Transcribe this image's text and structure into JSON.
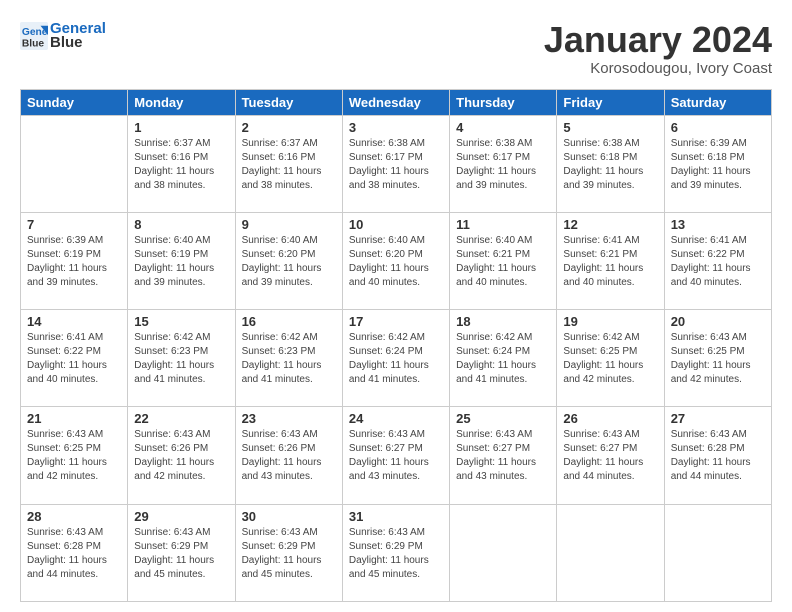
{
  "header": {
    "logo_line1": "General",
    "logo_line2": "Blue",
    "month_title": "January 2024",
    "location": "Korosodougou, Ivory Coast"
  },
  "weekdays": [
    "Sunday",
    "Monday",
    "Tuesday",
    "Wednesday",
    "Thursday",
    "Friday",
    "Saturday"
  ],
  "weeks": [
    [
      {
        "day": "",
        "sunrise": "",
        "sunset": "",
        "daylight": ""
      },
      {
        "day": "1",
        "sunrise": "Sunrise: 6:37 AM",
        "sunset": "Sunset: 6:16 PM",
        "daylight": "Daylight: 11 hours and 38 minutes."
      },
      {
        "day": "2",
        "sunrise": "Sunrise: 6:37 AM",
        "sunset": "Sunset: 6:16 PM",
        "daylight": "Daylight: 11 hours and 38 minutes."
      },
      {
        "day": "3",
        "sunrise": "Sunrise: 6:38 AM",
        "sunset": "Sunset: 6:17 PM",
        "daylight": "Daylight: 11 hours and 38 minutes."
      },
      {
        "day": "4",
        "sunrise": "Sunrise: 6:38 AM",
        "sunset": "Sunset: 6:17 PM",
        "daylight": "Daylight: 11 hours and 39 minutes."
      },
      {
        "day": "5",
        "sunrise": "Sunrise: 6:38 AM",
        "sunset": "Sunset: 6:18 PM",
        "daylight": "Daylight: 11 hours and 39 minutes."
      },
      {
        "day": "6",
        "sunrise": "Sunrise: 6:39 AM",
        "sunset": "Sunset: 6:18 PM",
        "daylight": "Daylight: 11 hours and 39 minutes."
      }
    ],
    [
      {
        "day": "7",
        "sunrise": "Sunrise: 6:39 AM",
        "sunset": "Sunset: 6:19 PM",
        "daylight": "Daylight: 11 hours and 39 minutes."
      },
      {
        "day": "8",
        "sunrise": "Sunrise: 6:40 AM",
        "sunset": "Sunset: 6:19 PM",
        "daylight": "Daylight: 11 hours and 39 minutes."
      },
      {
        "day": "9",
        "sunrise": "Sunrise: 6:40 AM",
        "sunset": "Sunset: 6:20 PM",
        "daylight": "Daylight: 11 hours and 39 minutes."
      },
      {
        "day": "10",
        "sunrise": "Sunrise: 6:40 AM",
        "sunset": "Sunset: 6:20 PM",
        "daylight": "Daylight: 11 hours and 40 minutes."
      },
      {
        "day": "11",
        "sunrise": "Sunrise: 6:40 AM",
        "sunset": "Sunset: 6:21 PM",
        "daylight": "Daylight: 11 hours and 40 minutes."
      },
      {
        "day": "12",
        "sunrise": "Sunrise: 6:41 AM",
        "sunset": "Sunset: 6:21 PM",
        "daylight": "Daylight: 11 hours and 40 minutes."
      },
      {
        "day": "13",
        "sunrise": "Sunrise: 6:41 AM",
        "sunset": "Sunset: 6:22 PM",
        "daylight": "Daylight: 11 hours and 40 minutes."
      }
    ],
    [
      {
        "day": "14",
        "sunrise": "Sunrise: 6:41 AM",
        "sunset": "Sunset: 6:22 PM",
        "daylight": "Daylight: 11 hours and 40 minutes."
      },
      {
        "day": "15",
        "sunrise": "Sunrise: 6:42 AM",
        "sunset": "Sunset: 6:23 PM",
        "daylight": "Daylight: 11 hours and 41 minutes."
      },
      {
        "day": "16",
        "sunrise": "Sunrise: 6:42 AM",
        "sunset": "Sunset: 6:23 PM",
        "daylight": "Daylight: 11 hours and 41 minutes."
      },
      {
        "day": "17",
        "sunrise": "Sunrise: 6:42 AM",
        "sunset": "Sunset: 6:24 PM",
        "daylight": "Daylight: 11 hours and 41 minutes."
      },
      {
        "day": "18",
        "sunrise": "Sunrise: 6:42 AM",
        "sunset": "Sunset: 6:24 PM",
        "daylight": "Daylight: 11 hours and 41 minutes."
      },
      {
        "day": "19",
        "sunrise": "Sunrise: 6:42 AM",
        "sunset": "Sunset: 6:25 PM",
        "daylight": "Daylight: 11 hours and 42 minutes."
      },
      {
        "day": "20",
        "sunrise": "Sunrise: 6:43 AM",
        "sunset": "Sunset: 6:25 PM",
        "daylight": "Daylight: 11 hours and 42 minutes."
      }
    ],
    [
      {
        "day": "21",
        "sunrise": "Sunrise: 6:43 AM",
        "sunset": "Sunset: 6:25 PM",
        "daylight": "Daylight: 11 hours and 42 minutes."
      },
      {
        "day": "22",
        "sunrise": "Sunrise: 6:43 AM",
        "sunset": "Sunset: 6:26 PM",
        "daylight": "Daylight: 11 hours and 42 minutes."
      },
      {
        "day": "23",
        "sunrise": "Sunrise: 6:43 AM",
        "sunset": "Sunset: 6:26 PM",
        "daylight": "Daylight: 11 hours and 43 minutes."
      },
      {
        "day": "24",
        "sunrise": "Sunrise: 6:43 AM",
        "sunset": "Sunset: 6:27 PM",
        "daylight": "Daylight: 11 hours and 43 minutes."
      },
      {
        "day": "25",
        "sunrise": "Sunrise: 6:43 AM",
        "sunset": "Sunset: 6:27 PM",
        "daylight": "Daylight: 11 hours and 43 minutes."
      },
      {
        "day": "26",
        "sunrise": "Sunrise: 6:43 AM",
        "sunset": "Sunset: 6:27 PM",
        "daylight": "Daylight: 11 hours and 44 minutes."
      },
      {
        "day": "27",
        "sunrise": "Sunrise: 6:43 AM",
        "sunset": "Sunset: 6:28 PM",
        "daylight": "Daylight: 11 hours and 44 minutes."
      }
    ],
    [
      {
        "day": "28",
        "sunrise": "Sunrise: 6:43 AM",
        "sunset": "Sunset: 6:28 PM",
        "daylight": "Daylight: 11 hours and 44 minutes."
      },
      {
        "day": "29",
        "sunrise": "Sunrise: 6:43 AM",
        "sunset": "Sunset: 6:29 PM",
        "daylight": "Daylight: 11 hours and 45 minutes."
      },
      {
        "day": "30",
        "sunrise": "Sunrise: 6:43 AM",
        "sunset": "Sunset: 6:29 PM",
        "daylight": "Daylight: 11 hours and 45 minutes."
      },
      {
        "day": "31",
        "sunrise": "Sunrise: 6:43 AM",
        "sunset": "Sunset: 6:29 PM",
        "daylight": "Daylight: 11 hours and 45 minutes."
      },
      {
        "day": "",
        "sunrise": "",
        "sunset": "",
        "daylight": ""
      },
      {
        "day": "",
        "sunrise": "",
        "sunset": "",
        "daylight": ""
      },
      {
        "day": "",
        "sunrise": "",
        "sunset": "",
        "daylight": ""
      }
    ]
  ]
}
